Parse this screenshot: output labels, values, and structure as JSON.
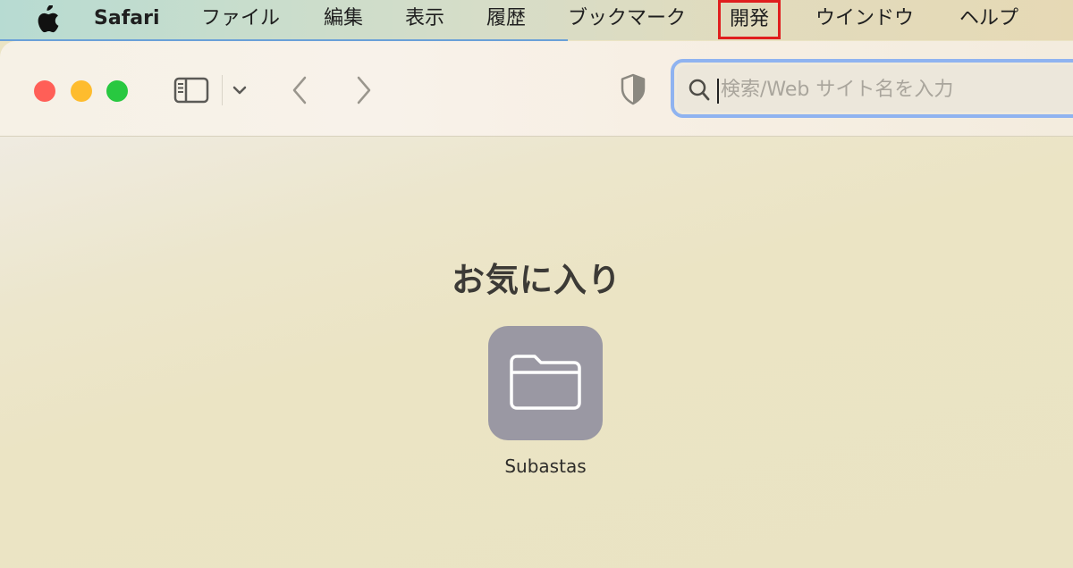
{
  "menubar": {
    "apple_icon": "apple-logo-icon",
    "app_name": "Safari",
    "items": [
      "ファイル",
      "編集",
      "表示",
      "履歴",
      "ブックマーク",
      "開発",
      "ウインドウ",
      "ヘルプ"
    ],
    "highlighted_item": "開発",
    "highlight_color": "#e01e1e"
  },
  "toolbar": {
    "traffic_lights": {
      "close_color": "#ff5f57",
      "minimize_color": "#febc2e",
      "zoom_color": "#28c840"
    },
    "icons": [
      "sidebar-icon",
      "chevron-down-icon",
      "back-icon",
      "forward-icon",
      "privacy-shield-icon"
    ],
    "search": {
      "placeholder": "検索/Web サイト名を入力",
      "value": "",
      "focus_color": "#8fb3f0"
    }
  },
  "start_page": {
    "favorites_title": "お気に入り",
    "favorites": [
      {
        "label": "Subastas",
        "icon": "folder-icon",
        "tile_color": "#9a98a3"
      }
    ]
  }
}
